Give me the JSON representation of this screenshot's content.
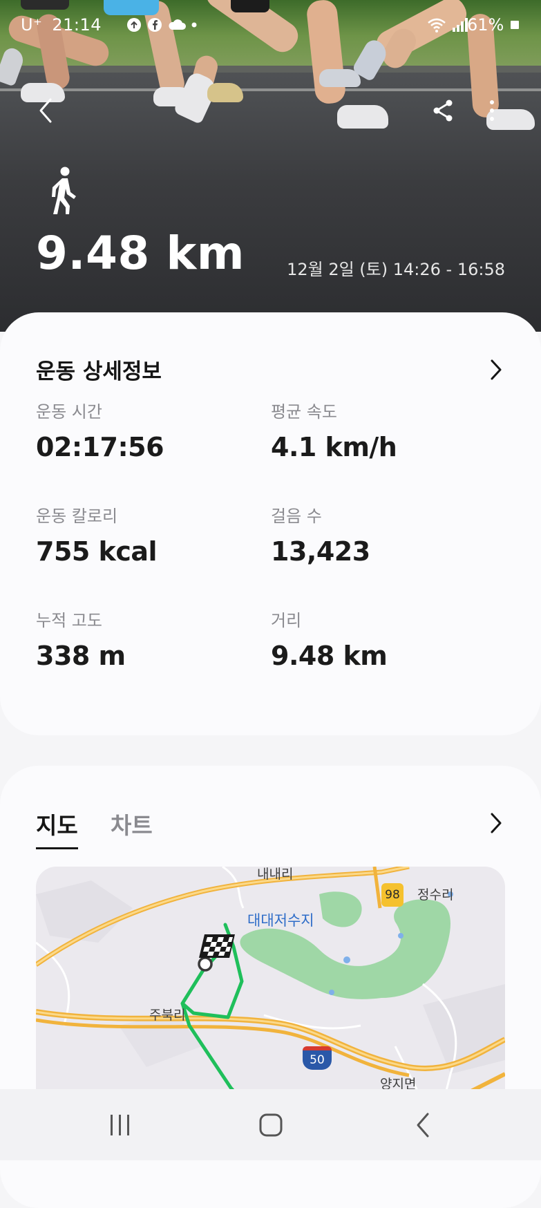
{
  "status_bar": {
    "carrier": "U⁺",
    "time": "21:14",
    "battery": "61%",
    "left_icons": [
      "sync-icon",
      "facebook-icon",
      "cloud-icon",
      "dot-icon"
    ],
    "right_icons": [
      "wifi-icon",
      "signal-icon",
      "battery-icon"
    ]
  },
  "header": {
    "back_icon": "chevron-left-icon",
    "share_icon": "share-icon",
    "more_icon": "more-vertical-icon",
    "activity_icon": "walking-icon",
    "distance": "9.48 km",
    "date_range": "12월 2일 (토) 14:26 - 16:58"
  },
  "details": {
    "title": "운동 상세정보",
    "stats": [
      {
        "label": "운동 시간",
        "value": "02:17:56"
      },
      {
        "label": "평균 속도",
        "value": "4.1 km/h"
      },
      {
        "label": "운동 칼로리",
        "value": "755 kcal"
      },
      {
        "label": "걸음 수",
        "value": "13,423"
      },
      {
        "label": "누적 고도",
        "value": "338 m"
      },
      {
        "label": "거리",
        "value": "9.48 km"
      }
    ]
  },
  "map_card": {
    "tabs": [
      {
        "label": "지도",
        "active": true
      },
      {
        "label": "차트",
        "active": false
      }
    ],
    "map_labels": {
      "naenae": "내내리",
      "route98": "98",
      "jeongsu": "정수리",
      "reservoir": "대대저수지",
      "jubuk": "주북리",
      "route50": "50",
      "yangji": "양지면"
    },
    "route_color": "#1fbf5b"
  },
  "navbar": {
    "recent_icon": "recent-apps-icon",
    "home_icon": "home-icon",
    "back_icon": "back-icon"
  },
  "colors": {
    "accent_route": "#1fbf5b",
    "card_bg": "#fbfbfd",
    "page_bg": "#f5f5f7"
  }
}
